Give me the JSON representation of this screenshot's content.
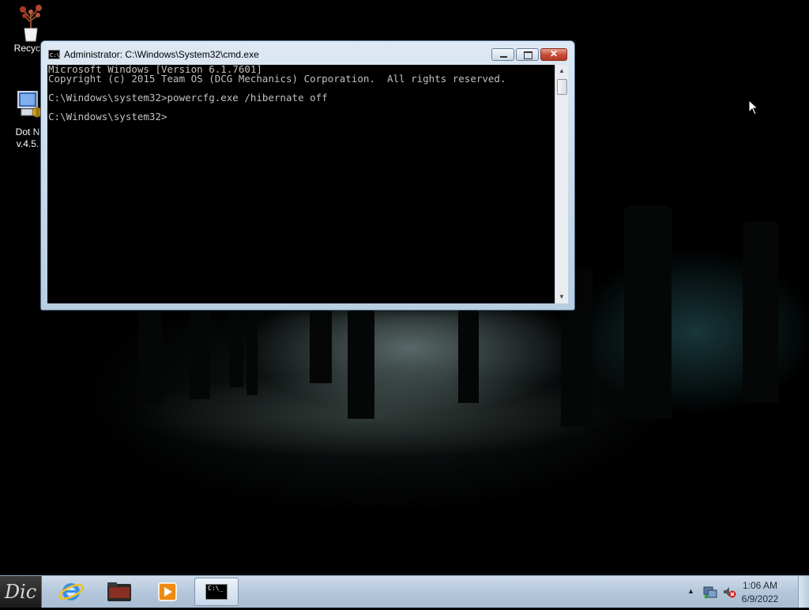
{
  "desktop": {
    "icons": [
      {
        "label": "Recycle",
        "icon": "recycle-bin-icon"
      },
      {
        "label_line1": "Dot N",
        "label_line2": "v.4.5.",
        "icon": "dotnet-installer-icon"
      }
    ]
  },
  "window": {
    "title": "Administrator: C:\\Windows\\System32\\cmd.exe",
    "icon_text": "C:\\",
    "console_lines": [
      "Microsoft Windows [Version 6.1.7601]",
      "Copyright (c) 2015 Team OS (DCG Mechanics) Corporation.  All rights reserved.",
      "",
      "C:\\Windows\\system32>powercfg.exe /hibernate off",
      "",
      "C:\\Windows\\system32>"
    ],
    "buttons": {
      "minimize": "minimize-icon",
      "maximize": "maximize-icon",
      "close": "close-icon"
    }
  },
  "taskbar": {
    "start_label": "Dic",
    "pinned": [
      {
        "name": "internet-explorer",
        "icon": "internet-explorer-icon"
      },
      {
        "name": "file-explorer",
        "icon": "folder-icon"
      },
      {
        "name": "media-player",
        "icon": "media-player-icon"
      },
      {
        "name": "command-prompt",
        "icon": "command-prompt-icon",
        "active": true
      }
    ],
    "cmd_icon_text": "C:\\_",
    "tray": {
      "icons": [
        "show-hidden-icons-icon",
        "network-icon",
        "volume-muted-icon"
      ],
      "time": "1:06 AM",
      "date": "6/9/2022"
    }
  },
  "colors": {
    "console_bg": "#000000",
    "console_fg": "#c0c0c0",
    "taskbar": "#b9cadc",
    "close_button": "#c74a35"
  }
}
